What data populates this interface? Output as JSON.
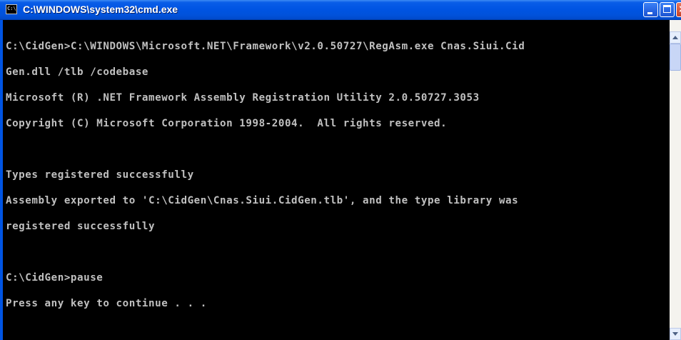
{
  "window": {
    "title": "C:\\WINDOWS\\system32\\cmd.exe",
    "icon_label": "C:\\",
    "icon": "cmd-icon"
  },
  "title_buttons": {
    "minimize": "minimize-icon",
    "maximize": "maximize-icon",
    "close_glyph": "×"
  },
  "console": {
    "lines": [
      "C:\\CidGen>C:\\WINDOWS\\Microsoft.NET\\Framework\\v2.0.50727\\RegAsm.exe Cnas.Siui.Cid",
      "Gen.dll /tlb /codebase",
      "Microsoft (R) .NET Framework Assembly Registration Utility 2.0.50727.3053",
      "Copyright (C) Microsoft Corporation 1998-2004.  All rights reserved.",
      "",
      "Types registered successfully",
      "Assembly exported to 'C:\\CidGen\\Cnas.Siui.CidGen.tlb', and the type library was",
      "registered successfully",
      "",
      "C:\\CidGen>pause",
      "Press any key to continue . . ."
    ]
  },
  "scrollbar": {
    "up_icon": "scroll-up-arrow-icon",
    "down_icon": "scroll-down-arrow-icon"
  },
  "colors": {
    "title_bar": "#0054e3",
    "console_bg": "#000000",
    "console_fg": "#c0c0c0",
    "close_button": "#d7573c"
  }
}
